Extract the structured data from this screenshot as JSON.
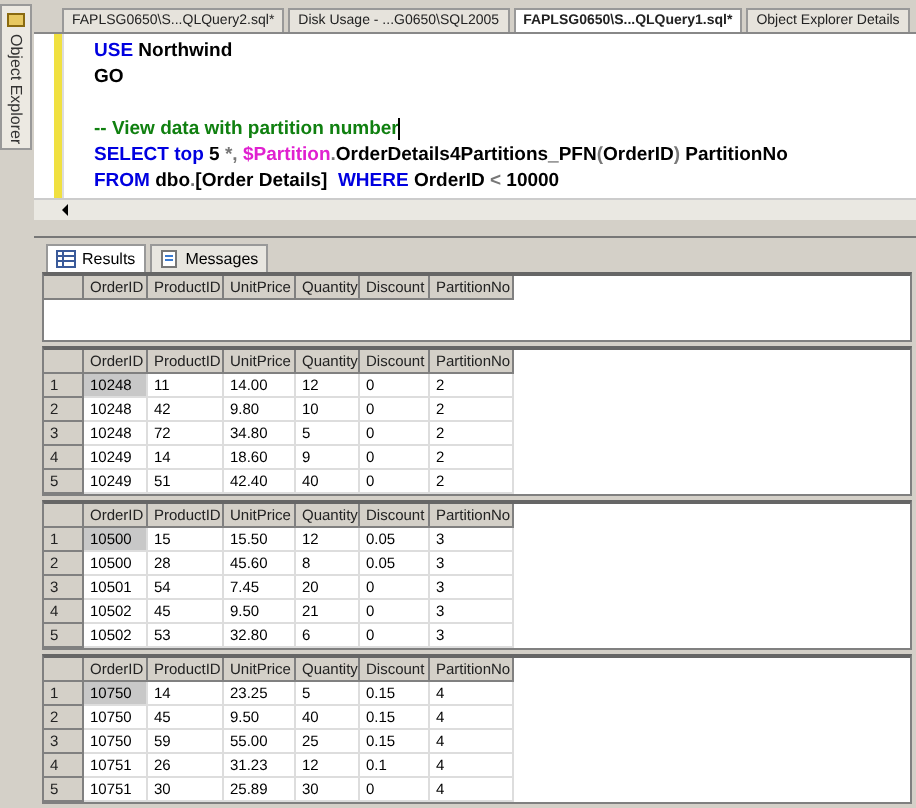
{
  "side_tab": {
    "label": "Object Explorer"
  },
  "tabs": [
    {
      "label": "FAPLSG0650\\S...QLQuery2.sql*",
      "selected": false
    },
    {
      "label": "Disk Usage - ...G0650\\SQL2005",
      "selected": false
    },
    {
      "label": "FAPLSG0650\\S...QLQuery1.sql*",
      "selected": true
    },
    {
      "label": "Object Explorer Details",
      "selected": false
    }
  ],
  "editor": {
    "lines": [
      {
        "kind": "code",
        "cursor": false,
        "tokens": [
          {
            "kind": "keyword",
            "text": "USE"
          },
          {
            "kind": "plain",
            "text": " Northwind"
          }
        ]
      },
      {
        "kind": "code",
        "cursor": false,
        "tokens": [
          {
            "kind": "plain",
            "text": "GO"
          }
        ]
      },
      {
        "kind": "blank"
      },
      {
        "kind": "code",
        "cursor": true,
        "tokens": [
          {
            "kind": "comment",
            "text": "-- View data with partition number"
          }
        ]
      },
      {
        "kind": "code",
        "cursor": false,
        "tokens": [
          {
            "kind": "keyword",
            "text": "SELECT"
          },
          {
            "kind": "keyword",
            "text": " top"
          },
          {
            "kind": "plain",
            "text": " 5"
          },
          {
            "kind": "operator",
            "text": " *,"
          },
          {
            "kind": "function",
            "text": " $Partition"
          },
          {
            "kind": "operator",
            "text": "."
          },
          {
            "kind": "plain",
            "text": "OrderDetails4Partitions_PFN"
          },
          {
            "kind": "operator",
            "text": "("
          },
          {
            "kind": "plain",
            "text": "OrderID"
          },
          {
            "kind": "operator",
            "text": ")"
          },
          {
            "kind": "plain",
            "text": " PartitionNo"
          }
        ]
      },
      {
        "kind": "code",
        "cursor": false,
        "tokens": [
          {
            "kind": "keyword",
            "text": "FROM"
          },
          {
            "kind": "plain",
            "text": " dbo"
          },
          {
            "kind": "operator",
            "text": "."
          },
          {
            "kind": "plain",
            "text": "[Order Details]"
          },
          {
            "kind": "keyword",
            "text": "  WHERE"
          },
          {
            "kind": "plain",
            "text": " OrderID"
          },
          {
            "kind": "operator",
            "text": " <"
          },
          {
            "kind": "plain",
            "text": " 10000"
          }
        ]
      }
    ]
  },
  "result_tabs": [
    {
      "label": "Results",
      "selected": true
    },
    {
      "label": "Messages",
      "selected": false
    }
  ],
  "grids": [
    {
      "columns": [
        "OrderID",
        "ProductID",
        "UnitPrice",
        "Quantity",
        "Discount",
        "PartitionNo"
      ]
    },
    {
      "columns": [
        "OrderID",
        "ProductID",
        "UnitPrice",
        "Quantity",
        "Discount",
        "PartitionNo"
      ],
      "rows": [
        {
          "number": "1",
          "selected": true,
          "cells": [
            "10248",
            "11",
            "14.00",
            "12",
            "0",
            "2"
          ]
        },
        {
          "number": "2",
          "selected": false,
          "cells": [
            "10248",
            "42",
            "9.80",
            "10",
            "0",
            "2"
          ]
        },
        {
          "number": "3",
          "selected": false,
          "cells": [
            "10248",
            "72",
            "34.80",
            "5",
            "0",
            "2"
          ]
        },
        {
          "number": "4",
          "selected": false,
          "cells": [
            "10249",
            "14",
            "18.60",
            "9",
            "0",
            "2"
          ]
        },
        {
          "number": "5",
          "selected": false,
          "cells": [
            "10249",
            "51",
            "42.40",
            "40",
            "0",
            "2"
          ]
        }
      ]
    },
    {
      "columns": [
        "OrderID",
        "ProductID",
        "UnitPrice",
        "Quantity",
        "Discount",
        "PartitionNo"
      ],
      "rows": [
        {
          "number": "1",
          "selected": true,
          "cells": [
            "10500",
            "15",
            "15.50",
            "12",
            "0.05",
            "3"
          ]
        },
        {
          "number": "2",
          "selected": false,
          "cells": [
            "10500",
            "28",
            "45.60",
            "8",
            "0.05",
            "3"
          ]
        },
        {
          "number": "3",
          "selected": false,
          "cells": [
            "10501",
            "54",
            "7.45",
            "20",
            "0",
            "3"
          ]
        },
        {
          "number": "4",
          "selected": false,
          "cells": [
            "10502",
            "45",
            "9.50",
            "21",
            "0",
            "3"
          ]
        },
        {
          "number": "5",
          "selected": false,
          "cells": [
            "10502",
            "53",
            "32.80",
            "6",
            "0",
            "3"
          ]
        }
      ]
    },
    {
      "columns": [
        "OrderID",
        "ProductID",
        "UnitPrice",
        "Quantity",
        "Discount",
        "PartitionNo"
      ],
      "rows": [
        {
          "number": "1",
          "selected": true,
          "cells": [
            "10750",
            "14",
            "23.25",
            "5",
            "0.15",
            "4"
          ]
        },
        {
          "number": "2",
          "selected": false,
          "cells": [
            "10750",
            "45",
            "9.50",
            "40",
            "0.15",
            "4"
          ]
        },
        {
          "number": "3",
          "selected": false,
          "cells": [
            "10750",
            "59",
            "55.00",
            "25",
            "0.15",
            "4"
          ]
        },
        {
          "number": "4",
          "selected": false,
          "cells": [
            "10751",
            "26",
            "31.23",
            "12",
            "0.1",
            "4"
          ]
        },
        {
          "number": "5",
          "selected": false,
          "cells": [
            "10751",
            "30",
            "25.89",
            "30",
            "0",
            "4"
          ]
        }
      ]
    }
  ]
}
